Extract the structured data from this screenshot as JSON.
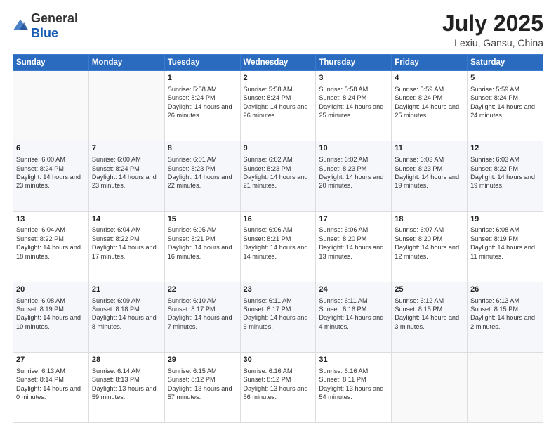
{
  "logo": {
    "general": "General",
    "blue": "Blue"
  },
  "header": {
    "month": "July 2025",
    "location": "Lexiu, Gansu, China"
  },
  "weekdays": [
    "Sunday",
    "Monday",
    "Tuesday",
    "Wednesday",
    "Thursday",
    "Friday",
    "Saturday"
  ],
  "weeks": [
    [
      {
        "day": "",
        "empty": true
      },
      {
        "day": "",
        "empty": true
      },
      {
        "day": "1",
        "sunrise": "Sunrise: 5:58 AM",
        "sunset": "Sunset: 8:24 PM",
        "daylight": "Daylight: 14 hours and 26 minutes."
      },
      {
        "day": "2",
        "sunrise": "Sunrise: 5:58 AM",
        "sunset": "Sunset: 8:24 PM",
        "daylight": "Daylight: 14 hours and 26 minutes."
      },
      {
        "day": "3",
        "sunrise": "Sunrise: 5:58 AM",
        "sunset": "Sunset: 8:24 PM",
        "daylight": "Daylight: 14 hours and 25 minutes."
      },
      {
        "day": "4",
        "sunrise": "Sunrise: 5:59 AM",
        "sunset": "Sunset: 8:24 PM",
        "daylight": "Daylight: 14 hours and 25 minutes."
      },
      {
        "day": "5",
        "sunrise": "Sunrise: 5:59 AM",
        "sunset": "Sunset: 8:24 PM",
        "daylight": "Daylight: 14 hours and 24 minutes."
      }
    ],
    [
      {
        "day": "6",
        "sunrise": "Sunrise: 6:00 AM",
        "sunset": "Sunset: 8:24 PM",
        "daylight": "Daylight: 14 hours and 23 minutes."
      },
      {
        "day": "7",
        "sunrise": "Sunrise: 6:00 AM",
        "sunset": "Sunset: 8:24 PM",
        "daylight": "Daylight: 14 hours and 23 minutes."
      },
      {
        "day": "8",
        "sunrise": "Sunrise: 6:01 AM",
        "sunset": "Sunset: 8:23 PM",
        "daylight": "Daylight: 14 hours and 22 minutes."
      },
      {
        "day": "9",
        "sunrise": "Sunrise: 6:02 AM",
        "sunset": "Sunset: 8:23 PM",
        "daylight": "Daylight: 14 hours and 21 minutes."
      },
      {
        "day": "10",
        "sunrise": "Sunrise: 6:02 AM",
        "sunset": "Sunset: 8:23 PM",
        "daylight": "Daylight: 14 hours and 20 minutes."
      },
      {
        "day": "11",
        "sunrise": "Sunrise: 6:03 AM",
        "sunset": "Sunset: 8:23 PM",
        "daylight": "Daylight: 14 hours and 19 minutes."
      },
      {
        "day": "12",
        "sunrise": "Sunrise: 6:03 AM",
        "sunset": "Sunset: 8:22 PM",
        "daylight": "Daylight: 14 hours and 19 minutes."
      }
    ],
    [
      {
        "day": "13",
        "sunrise": "Sunrise: 6:04 AM",
        "sunset": "Sunset: 8:22 PM",
        "daylight": "Daylight: 14 hours and 18 minutes."
      },
      {
        "day": "14",
        "sunrise": "Sunrise: 6:04 AM",
        "sunset": "Sunset: 8:22 PM",
        "daylight": "Daylight: 14 hours and 17 minutes."
      },
      {
        "day": "15",
        "sunrise": "Sunrise: 6:05 AM",
        "sunset": "Sunset: 8:21 PM",
        "daylight": "Daylight: 14 hours and 16 minutes."
      },
      {
        "day": "16",
        "sunrise": "Sunrise: 6:06 AM",
        "sunset": "Sunset: 8:21 PM",
        "daylight": "Daylight: 14 hours and 14 minutes."
      },
      {
        "day": "17",
        "sunrise": "Sunrise: 6:06 AM",
        "sunset": "Sunset: 8:20 PM",
        "daylight": "Daylight: 14 hours and 13 minutes."
      },
      {
        "day": "18",
        "sunrise": "Sunrise: 6:07 AM",
        "sunset": "Sunset: 8:20 PM",
        "daylight": "Daylight: 14 hours and 12 minutes."
      },
      {
        "day": "19",
        "sunrise": "Sunrise: 6:08 AM",
        "sunset": "Sunset: 8:19 PM",
        "daylight": "Daylight: 14 hours and 11 minutes."
      }
    ],
    [
      {
        "day": "20",
        "sunrise": "Sunrise: 6:08 AM",
        "sunset": "Sunset: 8:19 PM",
        "daylight": "Daylight: 14 hours and 10 minutes."
      },
      {
        "day": "21",
        "sunrise": "Sunrise: 6:09 AM",
        "sunset": "Sunset: 8:18 PM",
        "daylight": "Daylight: 14 hours and 8 minutes."
      },
      {
        "day": "22",
        "sunrise": "Sunrise: 6:10 AM",
        "sunset": "Sunset: 8:17 PM",
        "daylight": "Daylight: 14 hours and 7 minutes."
      },
      {
        "day": "23",
        "sunrise": "Sunrise: 6:11 AM",
        "sunset": "Sunset: 8:17 PM",
        "daylight": "Daylight: 14 hours and 6 minutes."
      },
      {
        "day": "24",
        "sunrise": "Sunrise: 6:11 AM",
        "sunset": "Sunset: 8:16 PM",
        "daylight": "Daylight: 14 hours and 4 minutes."
      },
      {
        "day": "25",
        "sunrise": "Sunrise: 6:12 AM",
        "sunset": "Sunset: 8:15 PM",
        "daylight": "Daylight: 14 hours and 3 minutes."
      },
      {
        "day": "26",
        "sunrise": "Sunrise: 6:13 AM",
        "sunset": "Sunset: 8:15 PM",
        "daylight": "Daylight: 14 hours and 2 minutes."
      }
    ],
    [
      {
        "day": "27",
        "sunrise": "Sunrise: 6:13 AM",
        "sunset": "Sunset: 8:14 PM",
        "daylight": "Daylight: 14 hours and 0 minutes."
      },
      {
        "day": "28",
        "sunrise": "Sunrise: 6:14 AM",
        "sunset": "Sunset: 8:13 PM",
        "daylight": "Daylight: 13 hours and 59 minutes."
      },
      {
        "day": "29",
        "sunrise": "Sunrise: 6:15 AM",
        "sunset": "Sunset: 8:12 PM",
        "daylight": "Daylight: 13 hours and 57 minutes."
      },
      {
        "day": "30",
        "sunrise": "Sunrise: 6:16 AM",
        "sunset": "Sunset: 8:12 PM",
        "daylight": "Daylight: 13 hours and 56 minutes."
      },
      {
        "day": "31",
        "sunrise": "Sunrise: 6:16 AM",
        "sunset": "Sunset: 8:11 PM",
        "daylight": "Daylight: 13 hours and 54 minutes."
      },
      {
        "day": "",
        "empty": true
      },
      {
        "day": "",
        "empty": true
      }
    ]
  ]
}
